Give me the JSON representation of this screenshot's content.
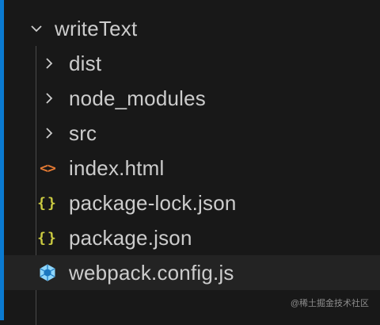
{
  "top_fragment": "",
  "tree": {
    "root": {
      "label": "writeText",
      "expanded": true
    },
    "items": [
      {
        "label": "dist",
        "type": "folder",
        "icon": "chevron-right-icon"
      },
      {
        "label": "node_modules",
        "type": "folder",
        "icon": "chevron-right-icon"
      },
      {
        "label": "src",
        "type": "folder",
        "icon": "chevron-right-icon"
      },
      {
        "label": "index.html",
        "type": "file",
        "icon": "html-file-icon",
        "icon_color": "#e37933"
      },
      {
        "label": "package-lock.json",
        "type": "file",
        "icon": "json-file-icon",
        "icon_color": "#cbcb41"
      },
      {
        "label": "package.json",
        "type": "file",
        "icon": "json-file-icon",
        "icon_color": "#cbcb41"
      },
      {
        "label": "webpack.config.js",
        "type": "file",
        "icon": "webpack-cube-icon",
        "icon_color": "#8ed6fb",
        "selected": true
      }
    ]
  },
  "icons": {
    "html_glyph": "<>",
    "json_glyph": "{}"
  },
  "watermark": "@稀土掘金技术社区",
  "colors": {
    "accent": "#0a7ad1",
    "background": "#181818",
    "text": "#cccccc"
  }
}
